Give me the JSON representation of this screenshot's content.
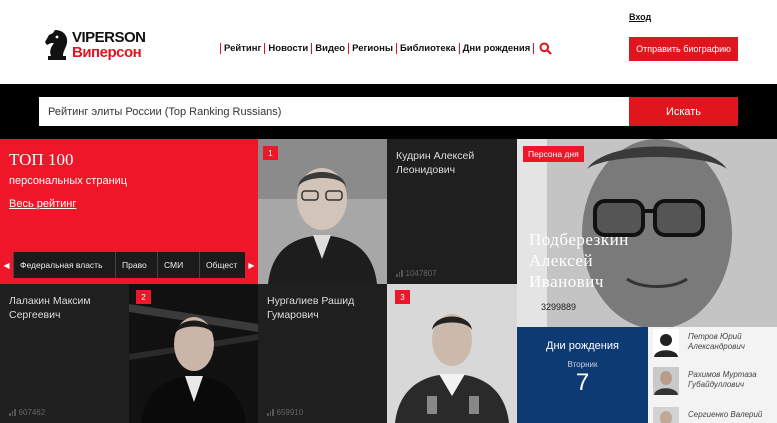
{
  "logo": {
    "latin": "VIPERSON",
    "cyrillic": "Виперсон"
  },
  "nav": [
    {
      "label": "Рейтинг"
    },
    {
      "label": "Новости"
    },
    {
      "label": "Видео"
    },
    {
      "label": "Регионы"
    },
    {
      "label": "Библиотека"
    },
    {
      "label": "Дни рождения"
    }
  ],
  "header": {
    "login": "Вход",
    "submit_bio": "Отправить биографию"
  },
  "search": {
    "value": "Рейтинг элиты России (Top Ranking Russians)",
    "button": "Искать"
  },
  "top100": {
    "title": "ТОП 100",
    "subtitle": "персональных страниц",
    "link": "Весь рейтинг",
    "tabs": [
      "Федеральная власть",
      "Право",
      "СМИ",
      "Общест"
    ]
  },
  "tiles": [
    {
      "name_line1": "Кудрин Алексей",
      "name_line2": "Леонидович",
      "count": "1047807",
      "rank": "1"
    },
    {
      "name_line1": "Лалакин Максим",
      "name_line2": "Сергеевич",
      "count": "607462",
      "rank": "2"
    },
    {
      "name_line1": "Нургалиев Рашид",
      "name_line2": "Гумарович",
      "count": "659910",
      "rank": "3"
    }
  ],
  "persona": {
    "badge": "Персона дня",
    "line1": "Подберезкин",
    "line2": "Алексей",
    "line3": "Иванович",
    "count": "3299889"
  },
  "birthdays": {
    "title": "Дни рождения",
    "weekday": "Вторник",
    "day": "7",
    "people": [
      {
        "line1": "Петров Юрий",
        "line2": "Александрович"
      },
      {
        "line1": "Рахимов Муртаза",
        "line2": "Губайдуллович"
      },
      {
        "line1": "Сергиенко Валерий",
        "line2": ""
      }
    ]
  },
  "colors": {
    "accent": "#e0161f",
    "tile_red": "#f0162a",
    "navy": "#0e3a73"
  }
}
